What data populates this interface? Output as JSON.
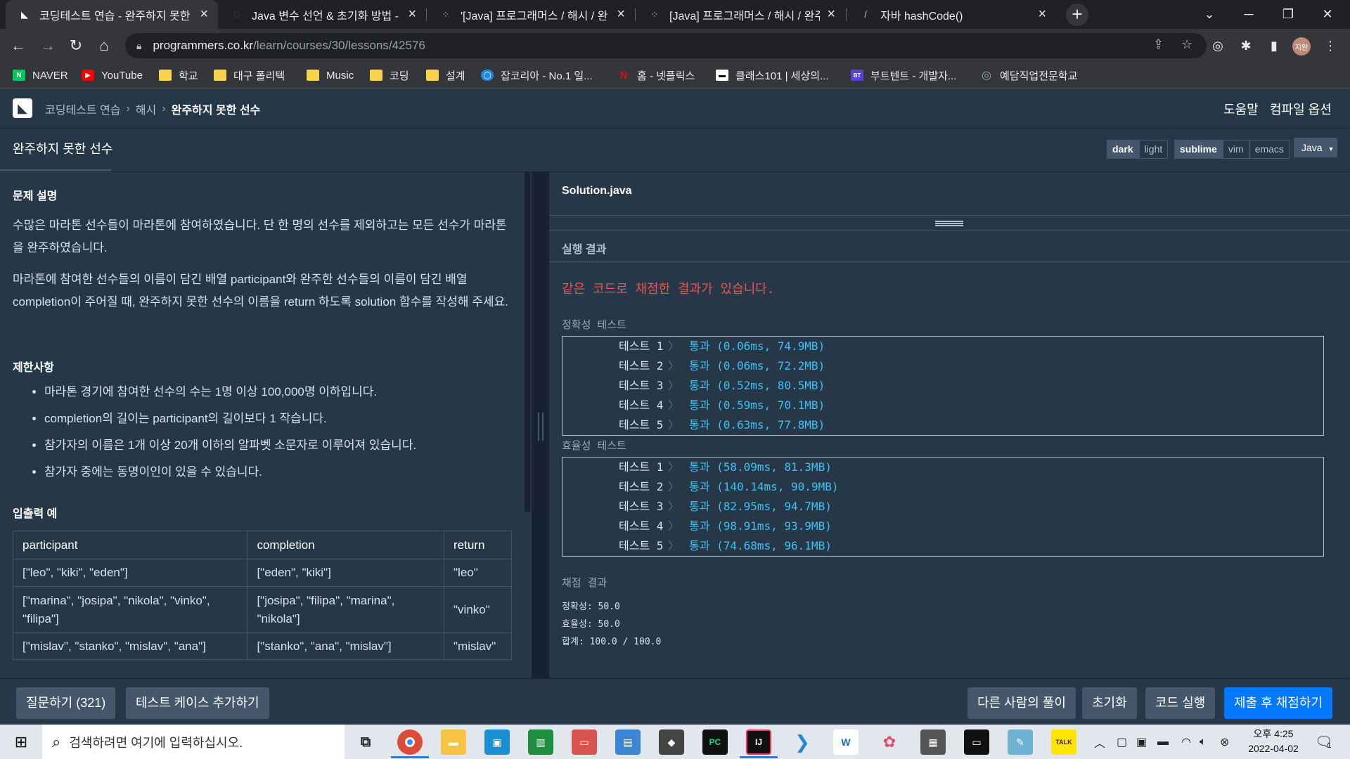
{
  "browser": {
    "tabs": [
      {
        "title": "코딩테스트 연습 - 완주하지 못한",
        "icon": "programmers-icon"
      },
      {
        "title": "Java 변수 선언 & 초기화 방법 -",
        "icon": "d-icon"
      },
      {
        "title": "'[Java] 프로그래머스 / 해시 / 완",
        "icon": "t-icon"
      },
      {
        "title": "[Java] 프로그래머스 / 해시 / 완주",
        "icon": "t-icon"
      },
      {
        "title": "자바 hashCode()",
        "icon": "slash-icon"
      }
    ],
    "url_host": "programmers.co.kr",
    "url_path": "/learn/courses/30/lessons/42576",
    "avatar_text": "지완",
    "bookmarks": [
      {
        "label": "NAVER",
        "icon": "N",
        "color": "#03c75a"
      },
      {
        "label": "YouTube",
        "icon": "▶",
        "color": "#ff0000"
      },
      {
        "label": "학교",
        "icon": "folder"
      },
      {
        "label": "대구 폴리텍",
        "icon": "folder"
      },
      {
        "label": "Music",
        "icon": "folder"
      },
      {
        "label": "코딩",
        "icon": "folder"
      },
      {
        "label": "설계",
        "icon": "folder"
      },
      {
        "label": "잡코리아 - No.1 일...",
        "icon": "◯",
        "color": "#1e88e5"
      },
      {
        "label": "홈 - 넷플릭스",
        "icon": "N",
        "color": "#e50914"
      },
      {
        "label": "클래스101 | 세상의...",
        "icon": "▬",
        "color": "#111111"
      },
      {
        "label": "부트텐트 - 개발자...",
        "icon": "BT",
        "color": "#5b3fd9"
      },
      {
        "label": "예담직업전문학교",
        "icon": "◎",
        "color": "#777777"
      }
    ]
  },
  "nav": {
    "breadcrumb": [
      "코딩테스트 연습",
      "해시",
      "완주하지 못한 선수"
    ],
    "help": "도움말",
    "compile_options": "컴파일 옵션"
  },
  "lesson": {
    "title": "완주하지 못한 선수",
    "theme_buttons": [
      "dark",
      "light"
    ],
    "keymap_buttons": [
      "sublime",
      "vim",
      "emacs"
    ],
    "language": "Java"
  },
  "problem": {
    "desc_heading": "문제 설명",
    "desc_p1": "수많은 마라톤 선수들이 마라톤에 참여하였습니다. 단 한 명의 선수를 제외하고는 모든 선수가 마라톤을 완주하였습니다.",
    "desc_p2": "마라톤에 참여한 선수들의 이름이 담긴 배열 participant와 완주한 선수들의 이름이 담긴 배열 completion이 주어질 때, 완주하지 못한 선수의 이름을 return 하도록 solution 함수를 작성해 주세요.",
    "limits_heading": "제한사항",
    "limits": [
      "마라톤 경기에 참여한 선수의 수는 1명 이상 100,000명 이하입니다.",
      "completion의 길이는 participant의 길이보다 1 작습니다.",
      "참가자의 이름은 1개 이상 20개 이하의 알파벳 소문자로 이루어져 있습니다.",
      "참가자 중에는 동명이인이 있을 수 있습니다."
    ],
    "io_heading": "입출력 예",
    "io_headers": [
      "participant",
      "completion",
      "return"
    ],
    "io_rows": [
      [
        "[\"leo\", \"kiki\", \"eden\"]",
        "[\"eden\", \"kiki\"]",
        "\"leo\""
      ],
      [
        "[\"marina\", \"josipa\", \"nikola\", \"vinko\", \"filipa\"]",
        "[\"josipa\", \"filipa\", \"marina\", \"nikola\"]",
        "\"vinko\""
      ],
      [
        "[\"mislav\", \"stanko\", \"mislav\", \"ana\"]",
        "[\"stanko\", \"ana\", \"mislav\"]",
        "\"mislav\""
      ]
    ]
  },
  "editor": {
    "filename": "Solution.java",
    "run_title": "실행 결과",
    "warning": "같은 코드로 채점한 결과가 있습니다.",
    "accuracy_label": "정확성  테스트",
    "accuracy_tests": [
      {
        "name": "테스트 1",
        "result": "통과 (0.06ms, 74.9MB)"
      },
      {
        "name": "테스트 2",
        "result": "통과 (0.06ms, 72.2MB)"
      },
      {
        "name": "테스트 3",
        "result": "통과 (0.52ms, 80.5MB)"
      },
      {
        "name": "테스트 4",
        "result": "통과 (0.59ms, 70.1MB)"
      },
      {
        "name": "테스트 5",
        "result": "통과 (0.63ms, 77.8MB)"
      }
    ],
    "efficiency_label": "효율성  테스트",
    "efficiency_tests": [
      {
        "name": "테스트 1",
        "result": "통과 (58.09ms, 81.3MB)"
      },
      {
        "name": "테스트 2",
        "result": "통과 (140.14ms, 90.9MB)"
      },
      {
        "name": "테스트 3",
        "result": "통과 (82.95ms, 94.7MB)"
      },
      {
        "name": "테스트 4",
        "result": "통과 (98.91ms, 93.9MB)"
      },
      {
        "name": "테스트 5",
        "result": "통과 (74.68ms, 96.1MB)"
      }
    ],
    "score_heading": "채점 결과",
    "score_accuracy": "정확성: 50.0",
    "score_efficiency": "효율성: 50.0",
    "score_total": "합계: 100.0 / 100.0"
  },
  "footer": {
    "ask": "질문하기 (321)",
    "add_testcase": "테스트 케이스 추가하기",
    "others": "다른 사람의 풀이",
    "reset": "초기화",
    "run": "코드 실행",
    "submit": "제출 후 채점하기"
  },
  "taskbar": {
    "search_placeholder": "검색하려면 여기에 입력하십시오.",
    "time": "오후 4:25",
    "date": "2022-04-02",
    "notif_count": "1"
  }
}
